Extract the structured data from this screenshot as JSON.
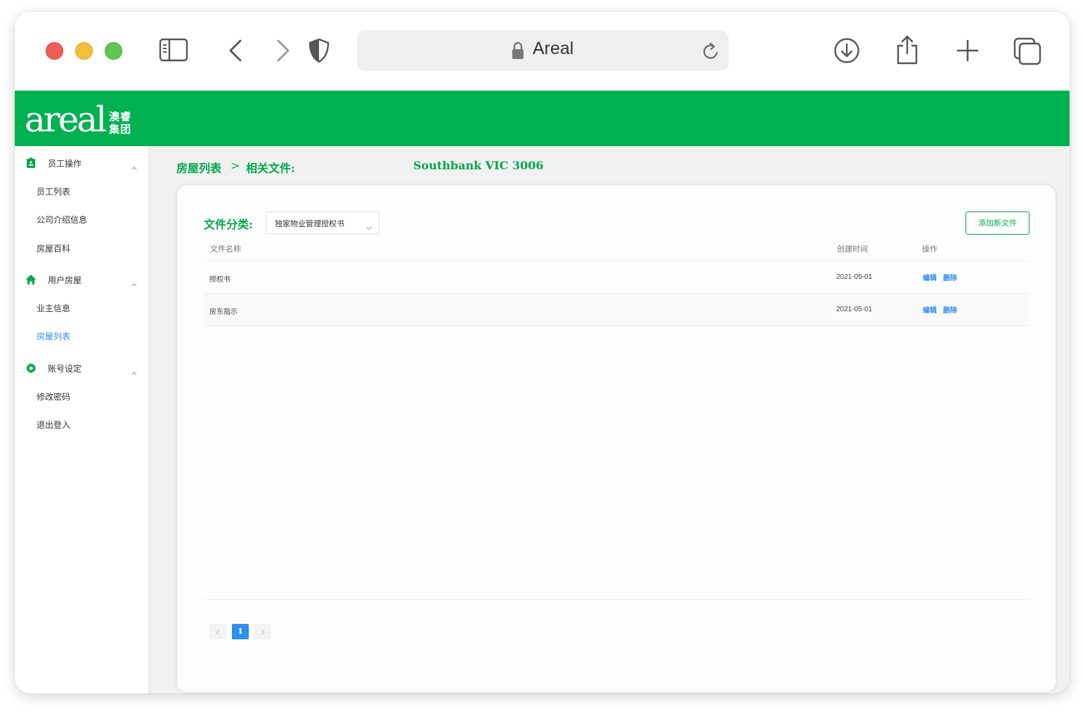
{
  "browser": {
    "url": "Areal",
    "icons": [
      "sidebar-toggle-icon",
      "back-chevron-icon",
      "forward-chevron-icon",
      "privacy-shield-icon",
      "lock-icon",
      "reload-icon",
      "download-icon",
      "share-icon",
      "new-tab-plus-icon",
      "tabs-overview-icon"
    ]
  },
  "header": {
    "logo_word": "areal",
    "logo_cn_line1": "澳睿",
    "logo_cn_line2": "集团",
    "brand_color": "#00b150"
  },
  "sidebar": {
    "groups": [
      {
        "label": "员工操作",
        "icon": "badge-icon",
        "items": [
          "员工列表",
          "公司介绍信息",
          "房屋百科"
        ]
      },
      {
        "label": "用户房屋",
        "icon": "home-icon",
        "items": [
          "业主信息",
          "房屋列表"
        ]
      },
      {
        "label": "账号设定",
        "icon": "gear-icon",
        "items": [
          "修改密码",
          "退出登入"
        ]
      }
    ],
    "active_item": "房屋列表",
    "active_color": "#2f8ff0"
  },
  "breadcrumb": {
    "root": "房屋列表",
    "separator": ">",
    "current": "相关文件:",
    "address": "Southbank VIC 3006"
  },
  "filter": {
    "label": "文件分类:",
    "selected": "独家物业管理授权书"
  },
  "add_button": "添加新文件",
  "table": {
    "columns": [
      "文件名称",
      "创建时间",
      "操作"
    ],
    "rows": [
      {
        "name": "授权书",
        "created": "2021-05-01",
        "edit": "编辑",
        "delete": "删除"
      },
      {
        "name": "房东指示",
        "created": "2021-05-01",
        "edit": "编辑",
        "delete": "删除"
      }
    ]
  },
  "pagination": {
    "current_page": "1"
  }
}
